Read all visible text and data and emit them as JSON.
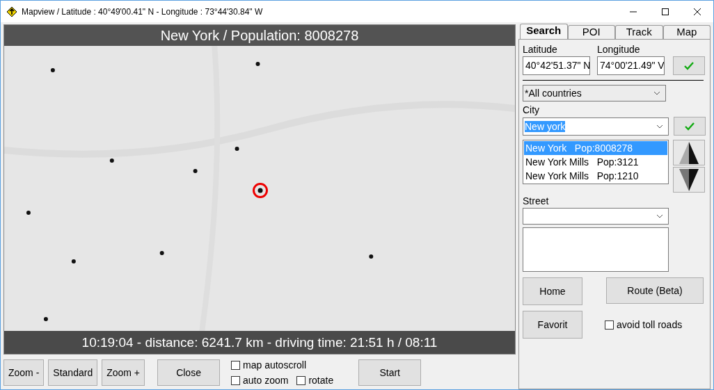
{
  "window": {
    "title": "Mapview / Latitude : 40°49'00.41\" N - Longitude : 73°44'30.84\" W"
  },
  "map": {
    "kind": "picture",
    "header": "New York / Population: 8008278",
    "footer": "10:19:04 - distance: 6241.7 km - driving time: 21:51 h / 08:11"
  },
  "tabs": [
    {
      "label": "Search",
      "selected": true
    },
    {
      "label": "POI",
      "selected": false
    },
    {
      "label": "Track",
      "selected": false
    },
    {
      "label": "Map",
      "selected": false
    }
  ],
  "search": {
    "latitude_label": "Latitude",
    "latitude": "40°42'51.37\" N",
    "longitude_label": "Longitude",
    "longitude": "74°00'21.49\" V",
    "country": "*All countries",
    "city_label": "City",
    "city": "New york",
    "cities": [
      {
        "name": "New York",
        "pop": "Pop:8008278",
        "selected": true
      },
      {
        "name": "New York Mills",
        "pop": "Pop:3121",
        "selected": false
      },
      {
        "name": "New York Mills",
        "pop": "Pop:1210",
        "selected": false
      }
    ],
    "street_label": "Street",
    "home": "Home",
    "route": "Route (Beta)",
    "favorit": "Favorit",
    "avoid_toll": {
      "label": "avoid toll roads",
      "checked": false
    }
  },
  "bottom": {
    "buttons": [
      "Zoom -",
      "Standard",
      "Zoom +",
      "Close"
    ],
    "checks": [
      {
        "label": "map autoscroll",
        "checked": false
      },
      {
        "label": "auto zoom",
        "checked": false
      },
      {
        "label": "rotate",
        "checked": false
      }
    ],
    "start": "Start"
  }
}
